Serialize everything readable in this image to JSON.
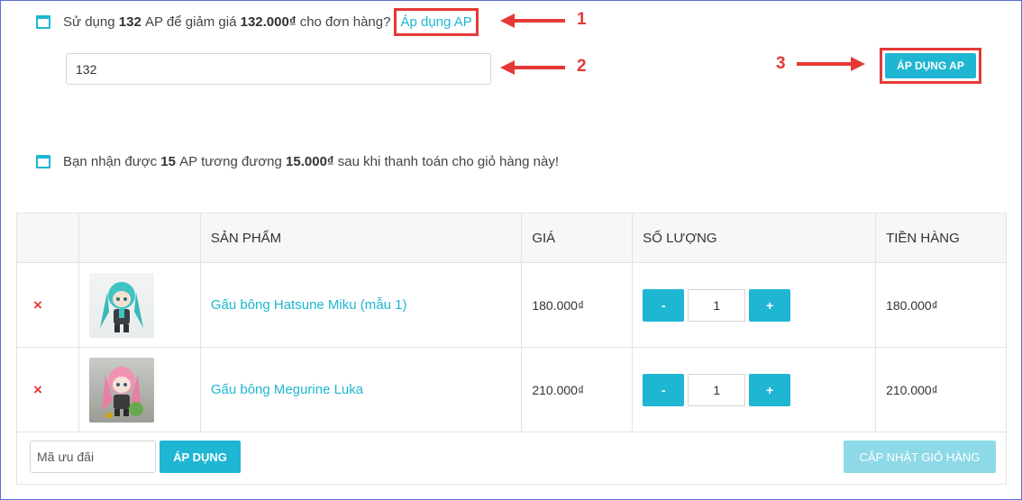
{
  "ap_notice": {
    "prefix": "Sử dụng",
    "ap_amount": "132",
    "mid": "AP để giảm giá",
    "discount": "132.000₫",
    "suffix": "cho đơn hàng?",
    "link": "Áp dụng AP"
  },
  "ap_input": {
    "value": "132"
  },
  "apply_ap_button": "ÁP DỤNG AP",
  "earn_notice": {
    "prefix": "Bạn nhận được",
    "ap_amount": "15",
    "mid": "AP tương đương",
    "value": "15.000₫",
    "suffix": "sau khi thanh toán cho giỏ hàng này!"
  },
  "annotations": [
    "1",
    "2",
    "3"
  ],
  "cart": {
    "headers": [
      "",
      "",
      "SẢN PHẨM",
      "GIÁ",
      "SỐ LƯỢNG",
      "TIỀN HÀNG"
    ],
    "rows": [
      {
        "remove": "×",
        "name": "Gấu bông Hatsune Miku (mẫu 1)",
        "price": "180.000₫",
        "minus": "-",
        "qty": "1",
        "plus": "+",
        "total": "180.000₫"
      },
      {
        "remove": "×",
        "name": "Gấu bông Megurine Luka",
        "price": "210.000₫",
        "minus": "-",
        "qty": "1",
        "plus": "+",
        "total": "210.000₫"
      }
    ]
  },
  "coupon": {
    "placeholder": "Mã ưu đãi",
    "apply_label": "ÁP DỤNG",
    "update_label": "CẬP NHẬT GIỎ HÀNG"
  },
  "colors": {
    "accent": "#1eb6d2",
    "annotation": "#e53935"
  }
}
